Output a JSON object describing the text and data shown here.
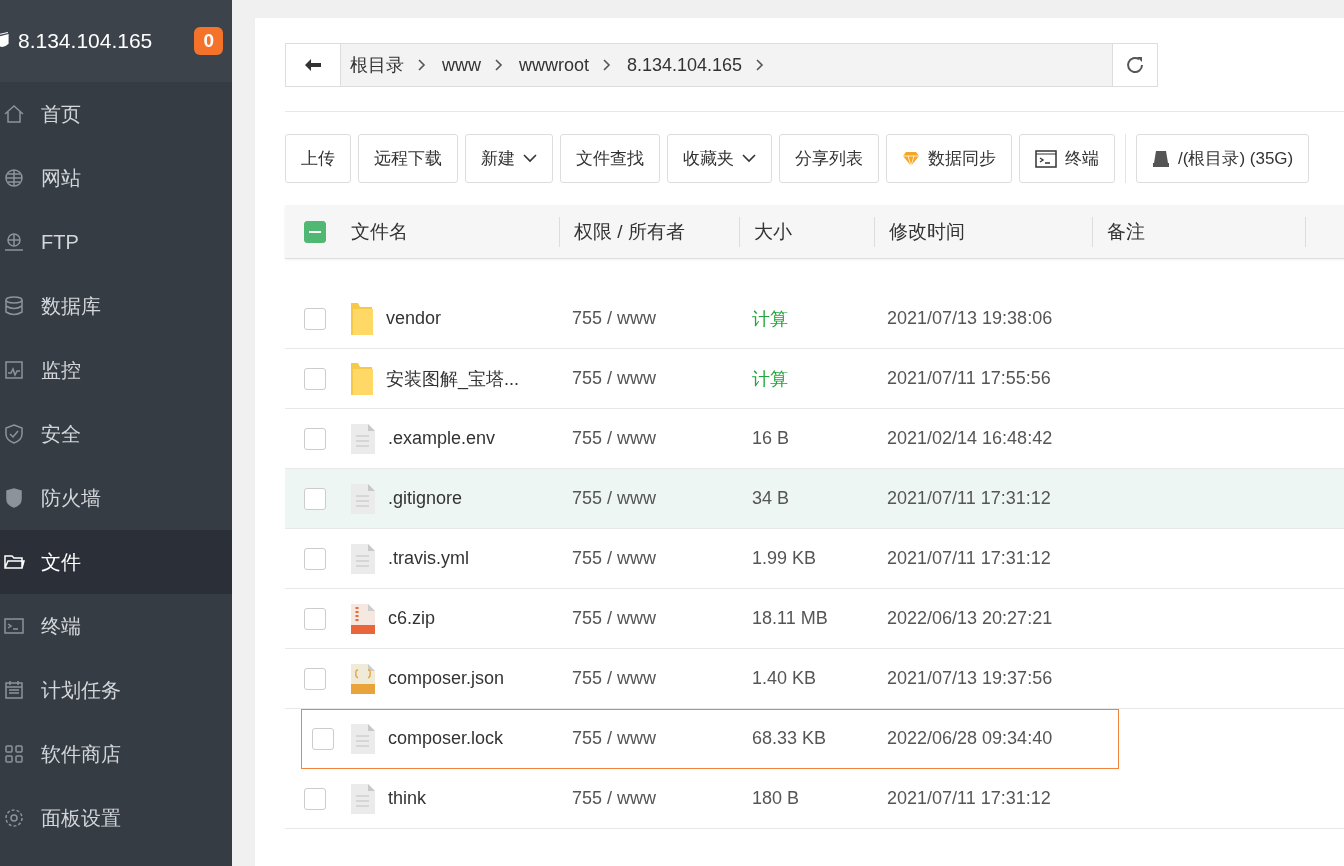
{
  "sidebar": {
    "server_name": "8.134.104.165",
    "badge": "0",
    "items": [
      {
        "label": "首页",
        "selected": false
      },
      {
        "label": "网站",
        "selected": false
      },
      {
        "label": "FTP",
        "selected": false
      },
      {
        "label": "数据库",
        "selected": false
      },
      {
        "label": "监控",
        "selected": false
      },
      {
        "label": "安全",
        "selected": false
      },
      {
        "label": "防火墙",
        "selected": false
      },
      {
        "label": "文件",
        "selected": true
      },
      {
        "label": "终端",
        "selected": false
      },
      {
        "label": "计划任务",
        "selected": false
      },
      {
        "label": "软件商店",
        "selected": false
      },
      {
        "label": "面板设置",
        "selected": false
      }
    ]
  },
  "breadcrumb": [
    "根目录",
    "www",
    "wwwroot",
    "8.134.104.165"
  ],
  "toolbar": [
    {
      "label": "上传",
      "kind": "plain"
    },
    {
      "label": "远程下载",
      "kind": "plain"
    },
    {
      "label": "新建",
      "kind": "dropdown"
    },
    {
      "label": "文件查找",
      "kind": "plain"
    },
    {
      "label": "收藏夹",
      "kind": "dropdown"
    },
    {
      "label": "分享列表",
      "kind": "plain"
    },
    {
      "label": "数据同步",
      "kind": "sync"
    },
    {
      "label": "终端",
      "kind": "terminal"
    },
    {
      "label": "/(根目录) (35G)",
      "kind": "disk"
    }
  ],
  "table": {
    "select_all_partial": true,
    "columns": [
      "文件名",
      "权限 / 所有者",
      "大小",
      "修改时间",
      "备注"
    ],
    "rows": [
      {
        "kind": "folder",
        "name": "vendor",
        "perm": "755 / www",
        "size": "计算",
        "time": "2021/07/13 19:38:06",
        "hover": false,
        "selected": false
      },
      {
        "kind": "folder",
        "name": "安装图解_宝塔...",
        "perm": "755 / www",
        "size": "计算",
        "time": "2021/07/11 17:55:56",
        "hover": false,
        "selected": false
      },
      {
        "kind": "file",
        "name": ".example.env",
        "perm": "755 / www",
        "size": "16 B",
        "time": "2021/02/14 16:48:42",
        "hover": false,
        "selected": false
      },
      {
        "kind": "file",
        "name": ".gitignore",
        "perm": "755 / www",
        "size": "34 B",
        "time": "2021/07/11 17:31:12",
        "hover": true,
        "selected": false
      },
      {
        "kind": "file",
        "name": ".travis.yml",
        "perm": "755 / www",
        "size": "1.99 KB",
        "time": "2021/07/11 17:31:12",
        "hover": false,
        "selected": false
      },
      {
        "kind": "zip",
        "name": "c6.zip",
        "perm": "755 / www",
        "size": "18.11 MB",
        "time": "2022/06/13 20:27:21",
        "hover": false,
        "selected": false
      },
      {
        "kind": "json",
        "name": "composer.json",
        "perm": "755 / www",
        "size": "1.40 KB",
        "time": "2021/07/13 19:37:56",
        "hover": false,
        "selected": false
      },
      {
        "kind": "file",
        "name": "composer.lock",
        "perm": "755 / www",
        "size": "68.33 KB",
        "time": "2022/06/28 09:34:40",
        "hover": false,
        "selected": true
      },
      {
        "kind": "file",
        "name": "think",
        "perm": "755 / www",
        "size": "180 B",
        "time": "2021/07/11 17:31:12",
        "hover": false,
        "selected": false
      }
    ]
  }
}
